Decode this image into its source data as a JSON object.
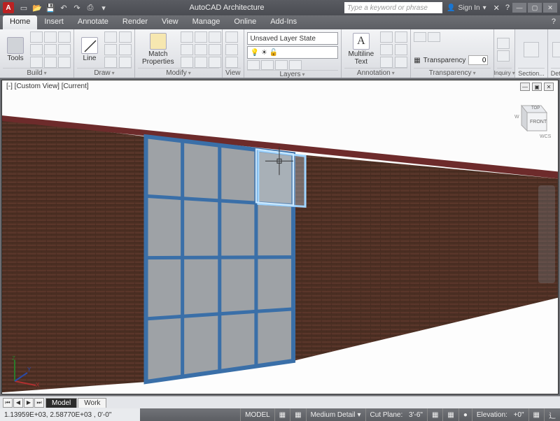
{
  "titlebar": {
    "app_name": "AutoCAD Architecture",
    "search_placeholder": "Type a keyword or phrase",
    "signin_label": "Sign In"
  },
  "menu": {
    "tabs": [
      "Home",
      "Insert",
      "Annotate",
      "Render",
      "View",
      "Manage",
      "Online",
      "Add-Ins"
    ],
    "active": "Home"
  },
  "ribbon": {
    "panels": {
      "build": {
        "title": "Build",
        "tools": "Tools"
      },
      "draw": {
        "title": "Draw",
        "line": "Line"
      },
      "modify": {
        "title": "Modify",
        "match": "Match\nProperties"
      },
      "view": {
        "title": "View"
      },
      "layers": {
        "title": "Layers",
        "state": "Unsaved Layer State"
      },
      "annotation": {
        "title": "Annotation",
        "mtext": "Multiline\nText"
      },
      "transparency": {
        "title": "Transparency",
        "label": "Transparency",
        "value": "0"
      },
      "inquiry": {
        "title": "Inquiry"
      },
      "section": {
        "title": "Section..."
      },
      "details": {
        "title": "Details"
      }
    }
  },
  "viewport": {
    "label": "[-] [Custom View] [Current]",
    "viewcube": {
      "top": "TOP",
      "front": "FRONT",
      "wcs": "WCS"
    },
    "ucs": {
      "x": "X",
      "y": "Y",
      "z": "Z"
    }
  },
  "bottom_tabs": [
    "Model",
    "Work"
  ],
  "status": {
    "coords": "1.13959E+03, 2.58770E+03 , 0'-0\"",
    "detail": "Medium Detail",
    "cutplane_label": "Cut Plane:",
    "cutplane_value": "3'-6\"",
    "elevation_label": "Elevation:",
    "elevation_value": "+0\"",
    "model": "MODEL"
  }
}
